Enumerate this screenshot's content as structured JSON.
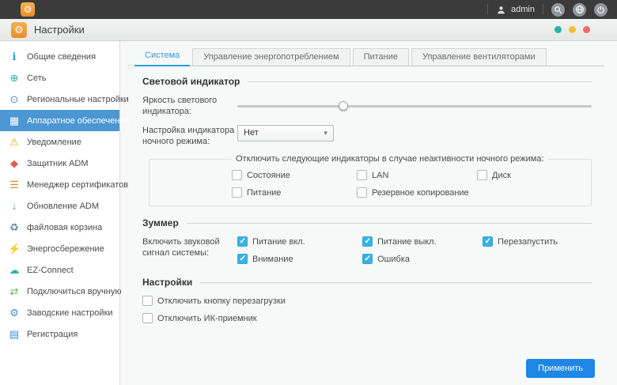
{
  "icons": {
    "gear": "⚙",
    "chevron_down": "▾",
    "check": "✓"
  },
  "topbar": {
    "user": "admin"
  },
  "window": {
    "title": "Настройки",
    "control_dot_colors": {
      "teal": "#27b3a9",
      "yellow": "#f2c12e",
      "red": "#ee6a6a"
    }
  },
  "sidebar": {
    "items": [
      {
        "label": "Общие сведения",
        "icon": "info-icon",
        "glyph": "ℹ",
        "color": "#2e9fd9",
        "selected": false
      },
      {
        "label": "Сеть",
        "icon": "network-globe-icon",
        "glyph": "⊕",
        "color": "#1fae9e",
        "selected": false
      },
      {
        "label": "Региональные настройки",
        "icon": "regional-clock-icon",
        "glyph": "⊙",
        "color": "#4a90d2",
        "selected": false
      },
      {
        "label": "Аппаратное обеспечение",
        "icon": "hardware-chip-icon",
        "glyph": "▦",
        "color": "#ffffff",
        "selected": true
      },
      {
        "label": "Уведомление",
        "icon": "notification-bell-icon",
        "glyph": "⚠",
        "color": "#f5a623",
        "selected": false
      },
      {
        "label": "Защитник ADM",
        "icon": "defender-shield-icon",
        "glyph": "◆",
        "color": "#e05c4b",
        "selected": false
      },
      {
        "label": "Менеджер сертификатов",
        "icon": "certificate-icon",
        "glyph": "☰",
        "color": "#e08a3c",
        "selected": false
      },
      {
        "label": "Обновление ADM",
        "icon": "adm-update-download-icon",
        "glyph": "↓",
        "color": "#3a8fd6",
        "selected": false
      },
      {
        "label": "файловая корзина",
        "icon": "recycle-bin-icon",
        "glyph": "♻",
        "color": "#5b7fa6",
        "selected": false
      },
      {
        "label": "Энергосбережение",
        "icon": "energy-saving-icon",
        "glyph": "⚡",
        "color": "#58b947",
        "selected": false
      },
      {
        "label": "EZ-Connect",
        "icon": "ez-connect-cloud-icon",
        "glyph": "☁",
        "color": "#27b3a9",
        "selected": false
      },
      {
        "label": "Подключиться вручную",
        "icon": "manual-connect-icon",
        "glyph": "⇄",
        "color": "#58b947",
        "selected": false
      },
      {
        "label": "Заводские настройки",
        "icon": "factory-settings-icon",
        "glyph": "⚙",
        "color": "#4a90d2",
        "selected": false
      },
      {
        "label": "Регистрация",
        "icon": "registration-doc-icon",
        "glyph": "▤",
        "color": "#3a8fd6",
        "selected": false
      }
    ]
  },
  "tabs": [
    {
      "label": "Система",
      "active": true
    },
    {
      "label": "Управление энергопотреблением",
      "active": false
    },
    {
      "label": "Питание",
      "active": false
    },
    {
      "label": "Управление вентиляторами",
      "active": false
    }
  ],
  "led_section": {
    "title": "Световой индикатор",
    "brightness_label": "Яркость светового индикатора:",
    "brightness_percent": 30,
    "night_mode_label": "Настройка индикатора ночного режима:",
    "night_mode_value": "Нет",
    "night_group_label": "Отключить следующие индикаторы в случае неактивности ночного режима:",
    "night_checkboxes": [
      {
        "label": "Состояние",
        "checked": false
      },
      {
        "label": "LAN",
        "checked": false
      },
      {
        "label": "Диск",
        "checked": false
      },
      {
        "label": "Питание",
        "checked": false
      },
      {
        "label": "Резервное копирование",
        "checked": false
      }
    ]
  },
  "buzzer_section": {
    "title": "Зуммер",
    "label": "Включить звуковой сигнал системы:",
    "checkboxes": [
      {
        "label": "Питание вкл.",
        "checked": true
      },
      {
        "label": "Питание выкл.",
        "checked": true
      },
      {
        "label": "Перезапустить",
        "checked": true
      },
      {
        "label": "Внимание",
        "checked": true
      },
      {
        "label": "Ошибка",
        "checked": true
      }
    ]
  },
  "settings_section": {
    "title": "Настройки",
    "checkboxes": [
      {
        "label": "Отключить кнопку перезагрузки",
        "checked": false
      },
      {
        "label": "Отключить ИК-приемник",
        "checked": false
      }
    ]
  },
  "footer": {
    "apply_label": "Применить"
  }
}
